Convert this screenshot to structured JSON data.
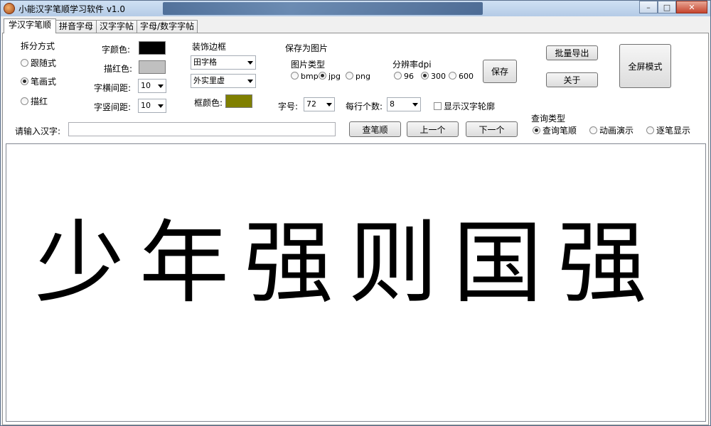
{
  "window": {
    "title": "小能汉字笔顺学习软件 v1.0",
    "controls": {
      "minimize": "–",
      "maximize": "□",
      "close": "✕"
    }
  },
  "tabs": [
    {
      "label": "学汉字笔顺"
    },
    {
      "label": "拼音字母"
    },
    {
      "label": "汉字字帖"
    },
    {
      "label": "字母/数字字帖"
    }
  ],
  "split": {
    "title": "拆分方式",
    "options": [
      "跟随式",
      "笔画式",
      "描红"
    ],
    "selected": "笔画式"
  },
  "colors_section": {
    "char_color_label": "字颜色:",
    "char_color": "#000000",
    "trace_color_label": "描红色:",
    "trace_color": "#c0c0c0",
    "h_spacing_label": "字横间距:",
    "h_spacing_value": "10",
    "v_spacing_label": "字竖间距:",
    "v_spacing_value": "10"
  },
  "border": {
    "title": "装饰边框",
    "grid_value": "田字格",
    "line_value": "外实里虚",
    "frame_color_label": "框颜色:",
    "frame_color": "#808000"
  },
  "save": {
    "title": "保存为图片",
    "type_title": "图片类型",
    "types": [
      "bmp",
      "jpg",
      "png"
    ],
    "type_selected": "jpg",
    "dpi_title": "分辨率dpi",
    "dpis": [
      "96",
      "300",
      "600"
    ],
    "dpi_selected": "300",
    "save_button": "保存"
  },
  "size": {
    "font_size_label": "字号:",
    "font_size_value": "72",
    "per_row_label": "每行个数:",
    "per_row_value": "8",
    "outline_label": "显示汉字轮廓"
  },
  "buttons": {
    "batch_export": "批量导出",
    "about": "关于",
    "fullscreen": "全屏模式"
  },
  "query": {
    "input_label": "请输入汉字:",
    "input_value": "",
    "search_button": "查笔顺",
    "prev_button": "上一个",
    "next_button": "下一个",
    "type_title": "查询类型",
    "types": [
      "查询笔顺",
      "动画演示",
      "逐笔显示"
    ],
    "type_selected": "查询笔顺"
  },
  "display": {
    "text": "少年强则国强"
  }
}
